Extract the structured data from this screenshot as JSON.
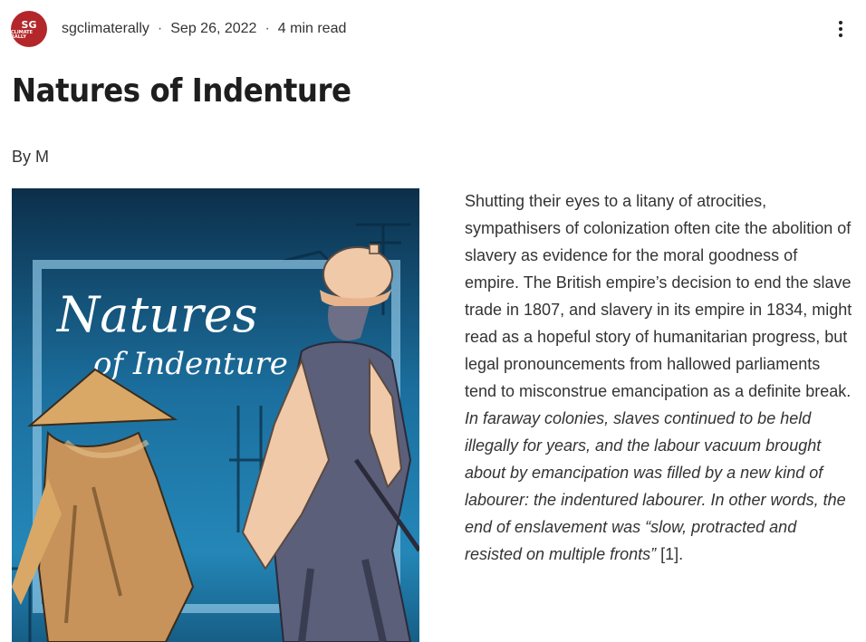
{
  "post_meta": {
    "avatar_text_top": "SG",
    "avatar_text_bottom": "CLIMATE RALLY",
    "author": "sgclimaterally",
    "separator": "·",
    "date": "Sep 26, 2022",
    "read_time": "4 min read"
  },
  "post": {
    "title": "Natures of Indenture",
    "byline": "By M",
    "image": {
      "title_line1": "Natures",
      "title_line2": "of Indenture"
    },
    "body": {
      "plain": "Shutting their eyes to a litany of atrocities, sympathisers of colonization often cite the abolition of slavery as evidence for the moral goodness of empire. The British empire’s decision to end the slave trade in 1807, and slavery in its empire in 1834, might read as a hopeful story of humanitarian progress, but legal pronouncements from hallowed parliaments tend to misconstrue emancipation as a definite break.",
      "italic": "In faraway colonies, slaves continued to be held illegally for years, and the labour vacuum brought about by emancipation was filled by a new kind of labourer: the indentured labourer. In other words, the end of enslavement was “slow, protracted and resisted on multiple fronts”",
      "citation": "[1]."
    }
  },
  "colors": {
    "avatar_bg": "#b3262a",
    "title_color": "#1e1e1e",
    "text_color": "#333333",
    "image_bg": "#0f3a55",
    "figure_tan": "#d9a867",
    "figure_peach": "#f0c9a8"
  },
  "icons": {
    "more": "more-vertical-icon"
  }
}
